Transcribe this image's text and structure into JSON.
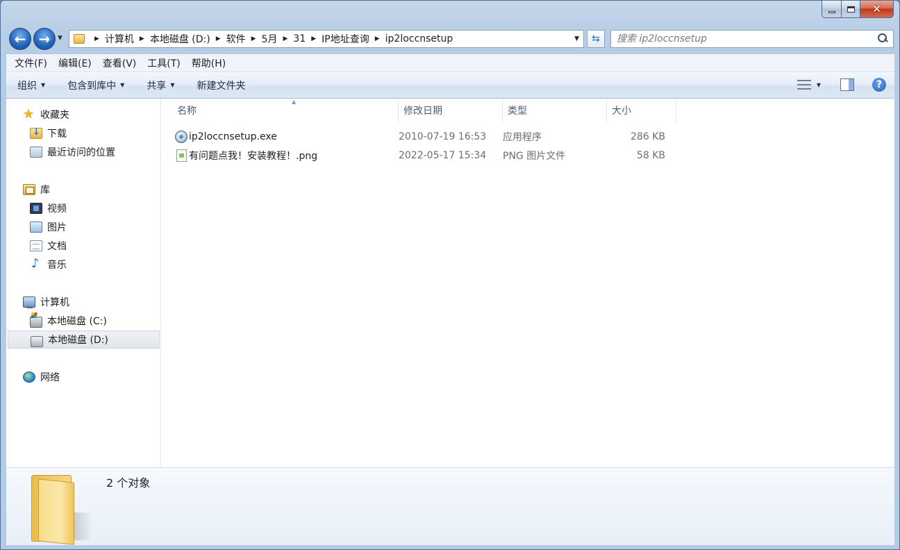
{
  "window": {
    "caption_buttons": {
      "minimize": "minimize",
      "maximize": "maximize",
      "close": "✕"
    }
  },
  "nav": {
    "back": "←",
    "forward": "→",
    "breadcrumbs": [
      "计算机",
      "本地磁盘 (D:)",
      "软件",
      "5月",
      "31",
      "IP地址查询",
      "ip2loccnsetup"
    ],
    "search_placeholder": "搜索 ip2loccnsetup"
  },
  "menubar": {
    "items": [
      "文件(F)",
      "编辑(E)",
      "查看(V)",
      "工具(T)",
      "帮助(H)"
    ]
  },
  "cmdbar": {
    "organize": "组织",
    "include_library": "包含到库中",
    "share": "共享",
    "new_folder": "新建文件夹",
    "help": "?"
  },
  "sidebar": {
    "favorites": {
      "label": "收藏夹",
      "items": [
        "下载",
        "最近访问的位置"
      ]
    },
    "libraries": {
      "label": "库",
      "items": [
        "视频",
        "图片",
        "文档",
        "音乐"
      ]
    },
    "computer": {
      "label": "计算机",
      "items": [
        "本地磁盘 (C:)",
        "本地磁盘 (D:)"
      ],
      "selected": "本地磁盘 (D:)"
    },
    "network": {
      "label": "网络"
    }
  },
  "file_list": {
    "columns": {
      "name": "名称",
      "date": "修改日期",
      "type": "类型",
      "size": "大小"
    },
    "files": [
      {
        "name": "ip2loccnsetup.exe",
        "date": "2010-07-19 16:53",
        "type": "应用程序",
        "size": "286 KB",
        "icon": "exe-icon"
      },
      {
        "name": "有问题点我！安装教程！.png",
        "date": "2022-05-17 15:34",
        "type": "PNG 图片文件",
        "size": "58 KB",
        "icon": "png-icon"
      }
    ]
  },
  "details": {
    "count": "2 个对象"
  },
  "colors": {
    "frame": "#b9cfe6",
    "close_red": "#c2391c",
    "selection": "#e2e6ec",
    "text_muted": "#6d6d6d"
  }
}
